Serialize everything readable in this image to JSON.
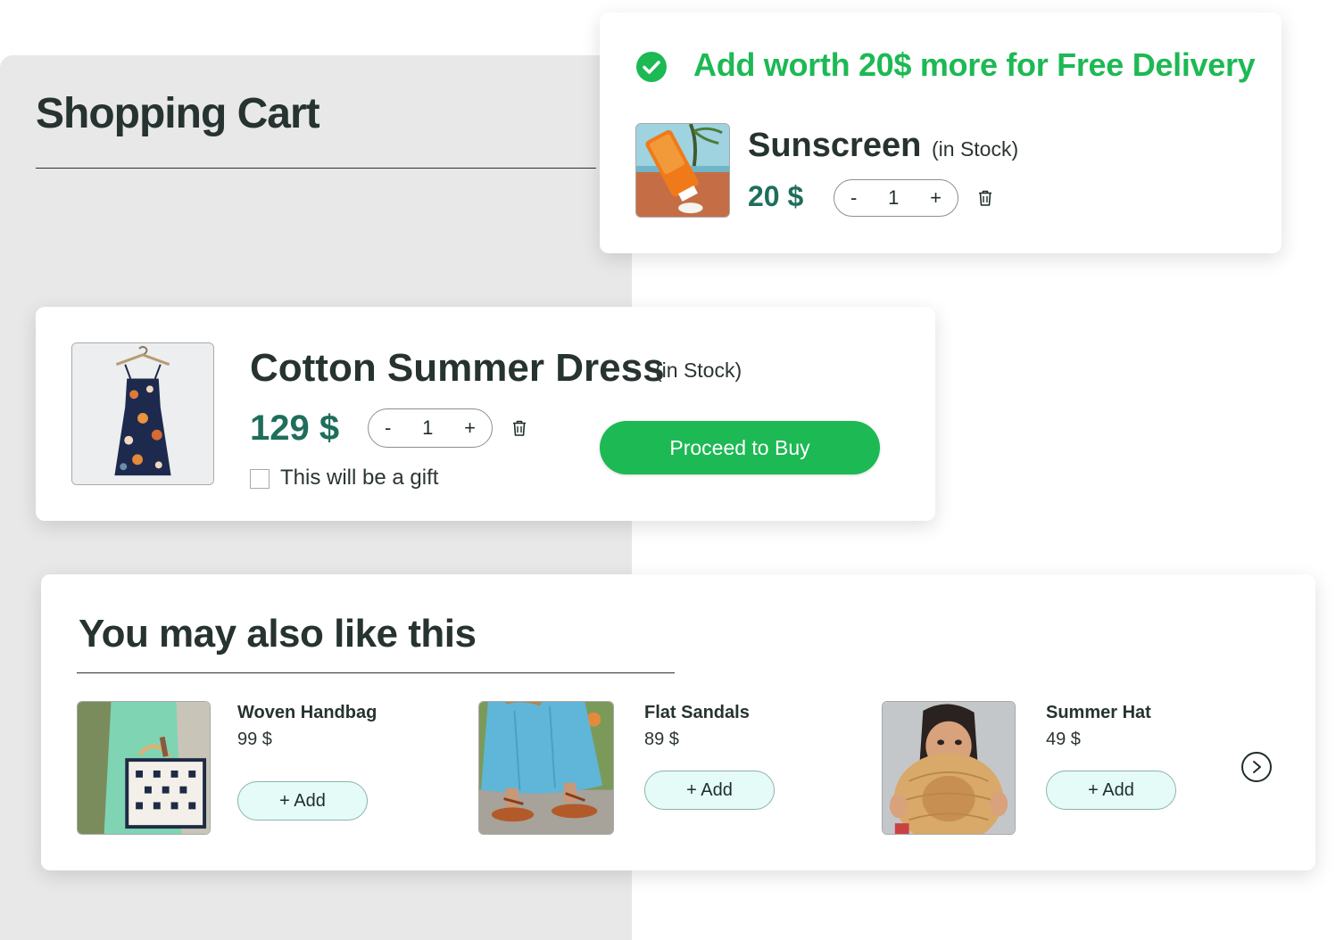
{
  "cart": {
    "title": "Shopping Cart"
  },
  "delivery_banner": {
    "message": "Add worth 20$ more for Free Delivery",
    "icon": "check-circle-icon",
    "color": "#1db954"
  },
  "cart_items": [
    {
      "name": "Sunscreen",
      "stock": "(in Stock)",
      "price": "20 $",
      "quantity": "1",
      "decrement": "-",
      "increment": "+"
    },
    {
      "name": "Cotton Summer Dress",
      "stock": "(in Stock)",
      "price": "129 $",
      "quantity": "1",
      "decrement": "-",
      "increment": "+",
      "gift_label": "This will be a gift",
      "gift_checked": false
    }
  ],
  "proceed_button": {
    "label": "Proceed to Buy"
  },
  "recommendations": {
    "title": "You may also like this",
    "items": [
      {
        "name": "Woven Handbag",
        "price": "99 $",
        "add_label": "+ Add"
      },
      {
        "name": "Flat Sandals",
        "price": "89 $",
        "add_label": "+ Add"
      },
      {
        "name": "Summer Hat",
        "price": "49 $",
        "add_label": "+ Add"
      }
    ],
    "next_icon": "chevron-right-icon"
  },
  "colors": {
    "accent_green": "#1db954",
    "price_green": "#1f6e5c",
    "heading": "#263330",
    "panel_bg": "#e8e8e8",
    "add_button_bg": "#e5fbf8"
  }
}
